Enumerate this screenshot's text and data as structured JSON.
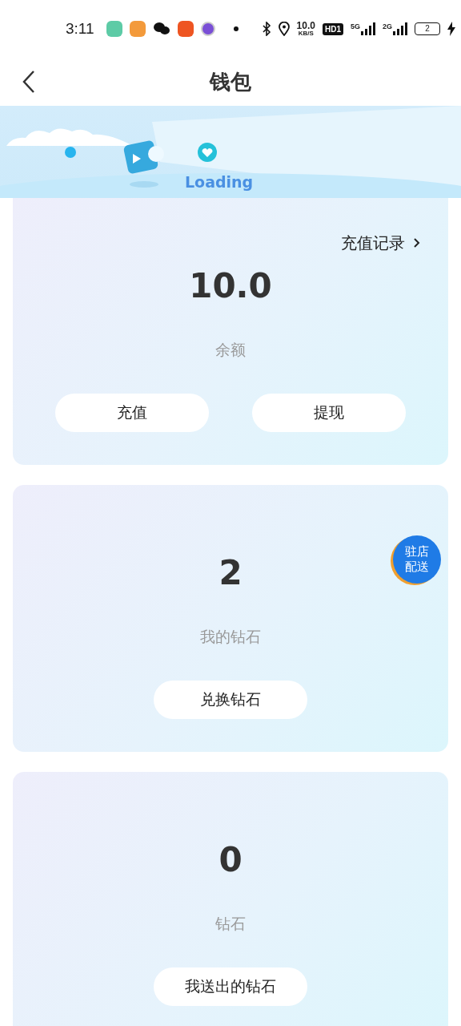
{
  "status_bar": {
    "time": "3:11",
    "net_speed": "10.0",
    "net_unit": "KB/S",
    "hd": "HD1",
    "sim1": "5G",
    "sim2": "2G",
    "battery": "2"
  },
  "header": {
    "title": "钱包"
  },
  "banner": {
    "text": "Loading"
  },
  "cards": [
    {
      "link": "充值记录",
      "value": "10.0",
      "label": "余额",
      "buttons": [
        "充值",
        "提现"
      ]
    },
    {
      "value": "2",
      "label": "我的钻石",
      "buttons": [
        "兑换钻石"
      ]
    },
    {
      "value": "0",
      "label": "钻石",
      "buttons": [
        "我送出的钻石"
      ]
    }
  ],
  "badge": {
    "lines": [
      "驻店",
      "配送"
    ]
  }
}
